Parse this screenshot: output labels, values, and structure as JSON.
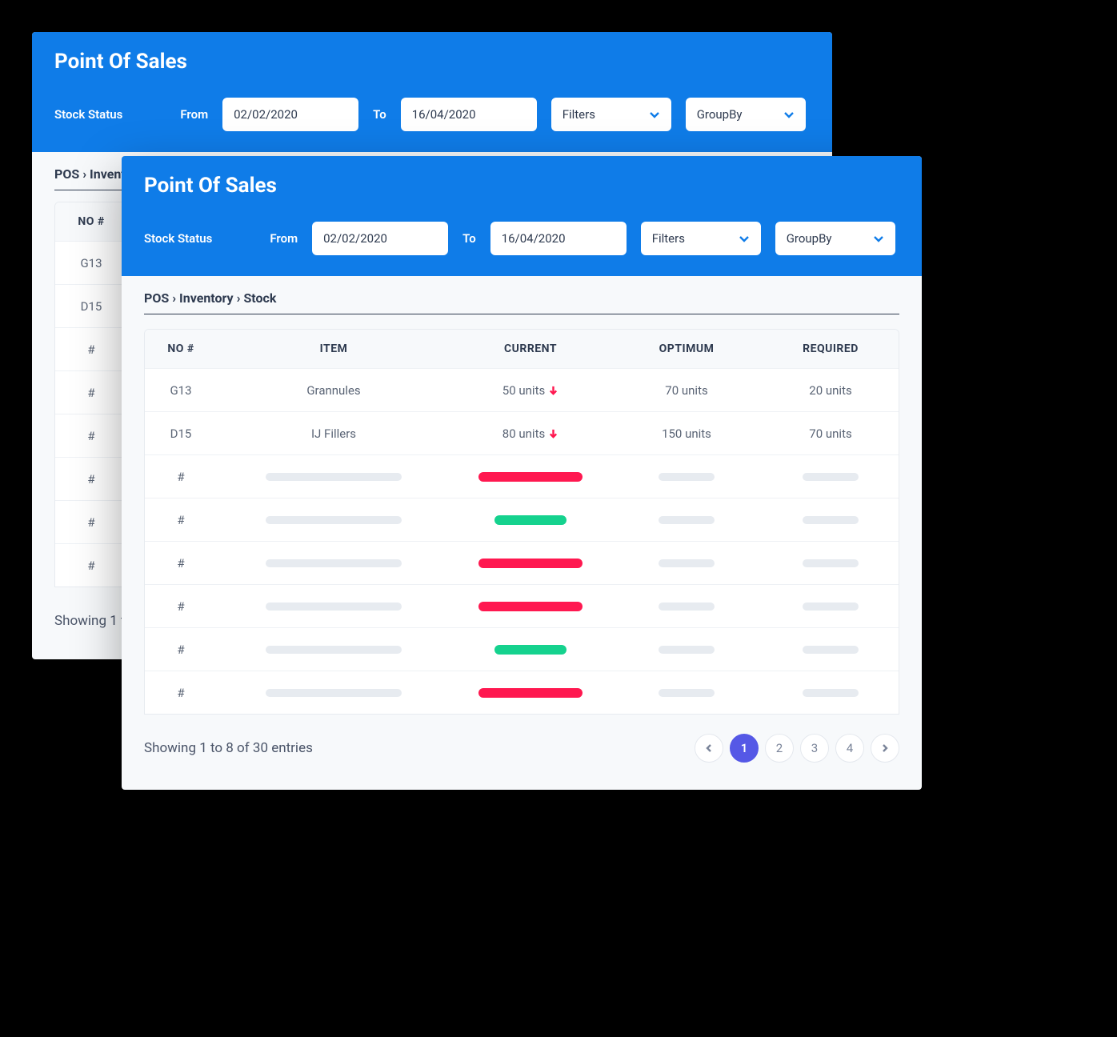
{
  "header": {
    "title": "Point Of Sales",
    "stock_status_label": "Stock Status",
    "from_label": "From",
    "to_label": "To",
    "from_date": "02/02/2020",
    "to_date": "16/04/2020",
    "filters_label": "Filters",
    "groupby_label": "GroupBy"
  },
  "breadcrumb": {
    "parts": [
      "POS",
      "Inventory",
      "Stock"
    ],
    "p0": "POS",
    "p1": "Inventory",
    "p2": "Stock"
  },
  "table": {
    "columns": {
      "no": "NO #",
      "item": "ITEM",
      "current": "CURRENT",
      "optimum": "OPTIMUM",
      "required": "REQUIRED"
    },
    "rows": [
      {
        "no": "G13",
        "item": "Grannules",
        "current": "50 units",
        "trend": "down",
        "optimum": "70 units",
        "required": "20 units"
      },
      {
        "no": "D15",
        "item": "IJ Fillers",
        "current": "80 units",
        "trend": "down",
        "optimum": "150 units",
        "required": "70 units"
      }
    ],
    "placeholder_rows": [
      {
        "no": "#",
        "current_color": "red"
      },
      {
        "no": "#",
        "current_color": "green"
      },
      {
        "no": "#",
        "current_color": "red"
      },
      {
        "no": "#",
        "current_color": "red"
      },
      {
        "no": "#",
        "current_color": "green"
      },
      {
        "no": "#",
        "current_color": "red"
      }
    ]
  },
  "footer": {
    "status": "Showing 1 to 8 of 30 entries",
    "pages": [
      "1",
      "2",
      "3",
      "4"
    ],
    "active_page": "1",
    "p1": "1",
    "p2": "2",
    "p3": "3",
    "p4": "4"
  },
  "icons": {
    "chevron_down": "chevron-down-icon",
    "arrow_down": "arrow-down-icon",
    "chevron_left": "chevron-left-icon",
    "chevron_right": "chevron-right-icon"
  },
  "colors": {
    "brand": "#0f7ce8",
    "accent": "#5558e6",
    "danger": "#ff1850",
    "success": "#15d28e"
  }
}
